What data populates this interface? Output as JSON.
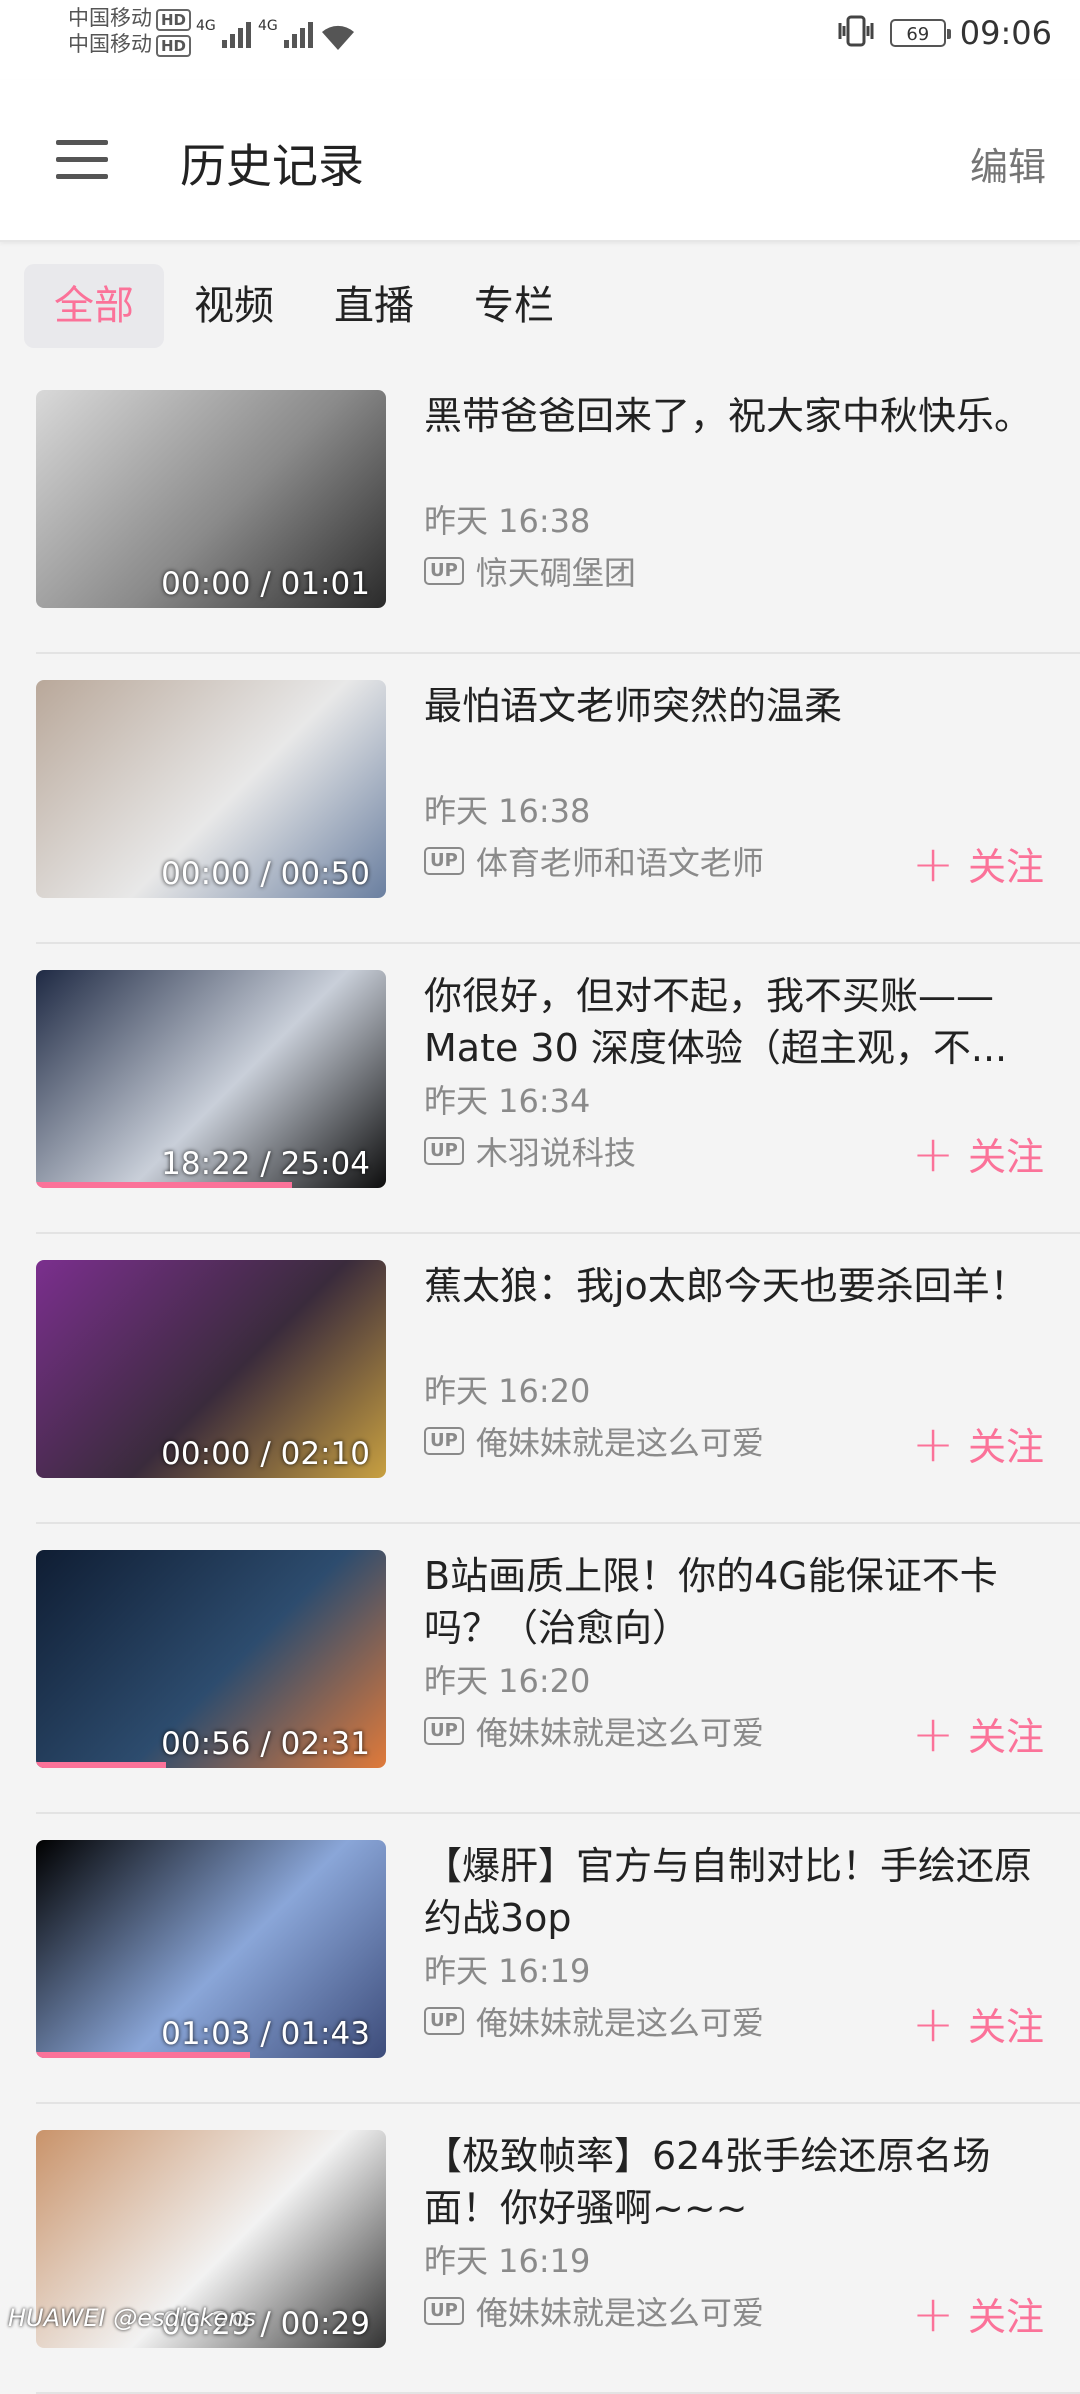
{
  "status": {
    "carrier1": "中国移动",
    "carrier2": "中国移动",
    "hd": "HD",
    "signal1": "4G",
    "signal2": "4G",
    "battery": "69",
    "time": "09:06"
  },
  "header": {
    "title": "历史记录",
    "edit_label": "编辑"
  },
  "tabs": [
    {
      "label": "全部",
      "active": true
    },
    {
      "label": "视频",
      "active": false
    },
    {
      "label": "直播",
      "active": false
    },
    {
      "label": "专栏",
      "active": false
    }
  ],
  "up_label": "UP",
  "follow_label": "关注",
  "items": [
    {
      "title": "黑带爸爸回来了，祝大家中秋快乐。",
      "time": "昨天 16:38",
      "uploader": "惊天碉堡团",
      "duration": "00:00 / 01:01",
      "progress": 0,
      "follow": false,
      "thumb_colors": [
        "#d9d9d9",
        "#8a8a8a",
        "#2a2a2a"
      ]
    },
    {
      "title": "最怕语文老师突然的温柔",
      "time": "昨天 16:38",
      "uploader": "体育老师和语文老师",
      "duration": "00:00 / 00:50",
      "progress": 0,
      "follow": true,
      "thumb_colors": [
        "#b9a89a",
        "#e8e8e8",
        "#6a7fa0"
      ]
    },
    {
      "title": "你很好，但对不起，我不买账——Mate 30 深度体验（超主观，不...",
      "time": "昨天 16:34",
      "uploader": "木羽说科技",
      "duration": "18:22 / 25:04",
      "progress": 0.73,
      "follow": true,
      "thumb_colors": [
        "#1f2a44",
        "#c9cfd9",
        "#0d0d0d"
      ]
    },
    {
      "title": "蕉太狼：我jo太郎今天也要杀回羊！",
      "time": "昨天 16:20",
      "uploader": "俺妹妹就是这么可爱",
      "duration": "00:00 / 02:10",
      "progress": 0,
      "follow": true,
      "thumb_colors": [
        "#7b2f8e",
        "#3a2b3c",
        "#c8a040"
      ]
    },
    {
      "title": "B站画质上限！你的4G能保证不卡吗？（治愈向）",
      "time": "昨天 16:20",
      "uploader": "俺妹妹就是这么可爱",
      "duration": "00:56 / 02:31",
      "progress": 0.37,
      "follow": true,
      "thumb_colors": [
        "#0f1d33",
        "#2d4c6e",
        "#e07a3a"
      ]
    },
    {
      "title": "【爆肝】官方与自制对比！手绘还原约战3op",
      "time": "昨天 16:19",
      "uploader": "俺妹妹就是这么可爱",
      "duration": "01:03 / 01:43",
      "progress": 0.61,
      "follow": true,
      "thumb_colors": [
        "#000000",
        "#8aa6d8",
        "#3d4c7a"
      ]
    },
    {
      "title": "【极致帧率】624张手绘还原名场面！你好骚啊~~~",
      "time": "昨天 16:19",
      "uploader": "俺妹妹就是这么可爱",
      "duration": "00:29 / 00:29",
      "progress": 0,
      "follow": true,
      "thumb_colors": [
        "#c9936a",
        "#f2f2f2",
        "#333333"
      ]
    }
  ],
  "watermark": "HUAWEI @esdickens"
}
